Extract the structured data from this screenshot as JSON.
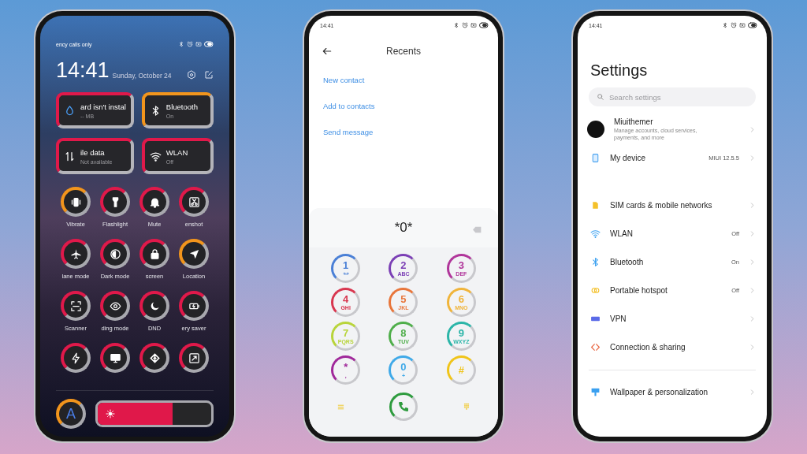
{
  "control_center": {
    "status_text": "ency calls only",
    "time": "14:41",
    "date": "Sunday, October 24",
    "cards": [
      {
        "title": "ard isn't instal",
        "subtitle": "-- MB",
        "color": "#e0194a"
      },
      {
        "title": "Bluetooth",
        "subtitle": "On",
        "color": "#f2951c"
      },
      {
        "title": "ile data",
        "subtitle": "Not available",
        "color": "#e0194a"
      },
      {
        "title": "WLAN",
        "subtitle": "Off",
        "color": "#e0194a"
      }
    ],
    "toggles": [
      {
        "label": "Vibrate",
        "color": "#f2951c"
      },
      {
        "label": "Flashlight",
        "color": "#e0194a"
      },
      {
        "label": "Mute",
        "color": "#e0194a"
      },
      {
        "label": "enshot",
        "color": "#e0194a"
      },
      {
        "label": "lane mode",
        "color": "#e0194a"
      },
      {
        "label": "Dark mode",
        "color": "#e0194a"
      },
      {
        "label": "screen",
        "color": "#e0194a"
      },
      {
        "label": "Location",
        "color": "#f2951c"
      },
      {
        "label": "Scanner",
        "color": "#e0194a"
      },
      {
        "label": "ding mode",
        "color": "#e0194a"
      },
      {
        "label": "DND",
        "color": "#e0194a"
      },
      {
        "label": "ery saver",
        "color": "#e0194a"
      },
      {
        "color": "#e0194a"
      },
      {
        "color": "#e0194a"
      },
      {
        "color": "#e0194a"
      },
      {
        "color": "#e0194a"
      }
    ],
    "auto_brightness": {
      "glyph": "A",
      "color": "#f2951c"
    },
    "brightness": {
      "level": 0.66
    }
  },
  "dialer": {
    "time": "14:41",
    "title": "Recents",
    "actions": [
      "New contact",
      "Add to contacts",
      "Send message"
    ],
    "display": "*0*",
    "keys": [
      {
        "digit": "1",
        "color": "#4a7fd6"
      },
      {
        "digit": "2",
        "letters": "ABC",
        "color": "#7b3fb5"
      },
      {
        "digit": "3",
        "letters": "DEF",
        "color": "#b0359a"
      },
      {
        "digit": "4",
        "letters": "GHI",
        "color": "#d8364f"
      },
      {
        "digit": "5",
        "letters": "JKL",
        "color": "#e8753a"
      },
      {
        "digit": "6",
        "letters": "MNO",
        "color": "#f0b43a"
      },
      {
        "digit": "7",
        "letters": "PQRS",
        "color": "#b8d43a"
      },
      {
        "digit": "8",
        "letters": "TUV",
        "color": "#4fae4a"
      },
      {
        "digit": "9",
        "letters": "WXYZ",
        "color": "#2bb5a8"
      },
      {
        "digit": "*",
        "letters": ",",
        "color": "#a0289a"
      },
      {
        "digit": "0",
        "letters": "+",
        "color": "#3fa9e8"
      },
      {
        "digit": "#",
        "color": "#f0c419"
      }
    ]
  },
  "settings": {
    "time": "14:41",
    "title": "Settings",
    "search_placeholder": "Search settings",
    "account": {
      "name": "Miuithemer",
      "description": "Manage accounts, cloud services, payments, and more"
    },
    "groups": [
      [
        {
          "label": "My device",
          "value": "MIUI 12.5.5"
        }
      ],
      [
        {
          "label": "SIM cards & mobile networks"
        },
        {
          "label": "WLAN",
          "value": "Off"
        },
        {
          "label": "Bluetooth",
          "value": "On"
        },
        {
          "label": "Portable hotspot",
          "value": "Off"
        },
        {
          "label": "VPN"
        },
        {
          "label": "Connection & sharing"
        }
      ],
      [
        {
          "label": "Wallpaper & personalization"
        }
      ]
    ]
  }
}
